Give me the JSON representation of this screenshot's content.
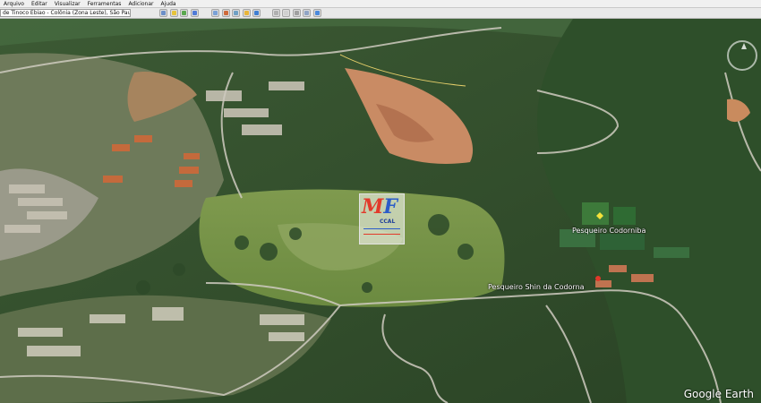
{
  "menu": {
    "items": [
      "Arquivo",
      "Editar",
      "Visualizar",
      "Ferramentas",
      "Adicionar",
      "Ajuda"
    ]
  },
  "toolbar": {
    "search_value": "de Tinoco Ebiao - Colônia (Zona Leste), São Paulo - SP",
    "buttons": [
      {
        "icon": "hide-sidebar-icon",
        "color": "#6c8fc7"
      },
      {
        "icon": "placemark-icon",
        "color": "#e6c33a"
      },
      {
        "icon": "polygon-icon",
        "color": "#5aa84e"
      },
      {
        "icon": "path-icon",
        "color": "#4f7ad6"
      },
      {
        "icon": "overlay-icon",
        "color": "#7aa1d6"
      },
      {
        "icon": "tour-icon",
        "color": "#cf6a3a"
      },
      {
        "icon": "historical-imagery-icon",
        "color": "#6fa0c4"
      },
      {
        "icon": "sun-icon",
        "color": "#e8b53a"
      },
      {
        "icon": "planet-icon",
        "color": "#3f7ed2"
      },
      {
        "icon": "ruler-icon",
        "color": "#b0b0b0"
      },
      {
        "icon": "email-icon",
        "color": "#d0d0d0"
      },
      {
        "icon": "print-icon",
        "color": "#a0a0a0"
      },
      {
        "icon": "save-image-icon",
        "color": "#90a4c4"
      },
      {
        "icon": "view-in-maps-icon",
        "color": "#4a89dc"
      }
    ]
  },
  "map": {
    "place_labels": [
      {
        "id": "pesqueiro-upper",
        "text": "Pesqueiro Codorniba"
      },
      {
        "id": "pesqueiro-lower",
        "text": "Pesqueiro Shin da Codorna"
      }
    ],
    "watermark": "Google Earth",
    "logo": {
      "letters_left": "M",
      "letters_right": "F",
      "subtitle": "CCAL"
    }
  }
}
